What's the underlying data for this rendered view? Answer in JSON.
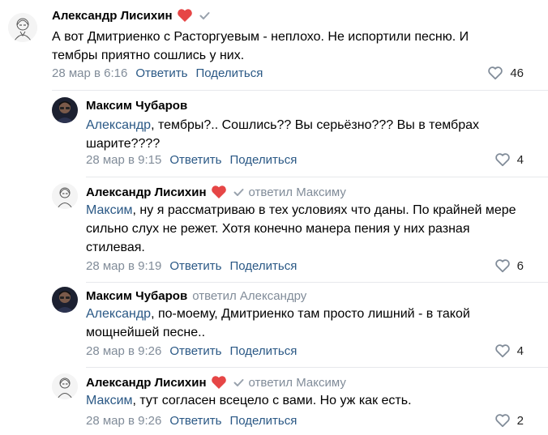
{
  "comments": [
    {
      "author": "Александр Лисихин",
      "replied_to": "",
      "mention": "",
      "text": "А вот Дмитриенко с Расторгуевым - неплохо. Не испортили песню. И тембры приятно сошлись у них.",
      "date": "28 мар в 6:16",
      "reply_label": "Ответить",
      "share_label": "Поделиться",
      "likes": "46",
      "avatar_icon": "sketch-portrait-avatar"
    },
    {
      "author": "Максим Чубаров",
      "replied_to": "",
      "mention": "Александр",
      "text": ", тембры?.. Сошлись?? Вы серьёзно??? Вы в тембрах шарите????",
      "date": "28 мар в 9:15",
      "reply_label": "Ответить",
      "share_label": "Поделиться",
      "likes": "4",
      "avatar_icon": "photo-avatar"
    },
    {
      "author": "Александр Лисихин",
      "replied_to": "ответил Максиму",
      "mention": "Максим",
      "text": ", ну я рассматриваю в тех условиях что даны. По крайней мере сильно слух не режет. Хотя конечно манера пения у них разная стилевая.",
      "date": "28 мар в 9:19",
      "reply_label": "Ответить",
      "share_label": "Поделиться",
      "likes": "6",
      "avatar_icon": "sketch-portrait-avatar"
    },
    {
      "author": "Максим Чубаров",
      "replied_to": "ответил Александру",
      "mention": "Александр",
      "text": ", по-моему, Дмитриенко там просто лишний - в такой мощнейшей песне..",
      "date": "28 мар в 9:26",
      "reply_label": "Ответить",
      "share_label": "Поделиться",
      "likes": "4",
      "avatar_icon": "photo-avatar"
    },
    {
      "author": "Александр Лисихин",
      "replied_to": "ответил Максиму",
      "mention": "Максим",
      "text": ", тут согласен всецело с вами. Но уж как есть.",
      "date": "28 мар в 9:26",
      "reply_label": "Ответить",
      "share_label": "Поделиться",
      "likes": "2",
      "avatar_icon": "sketch-portrait-avatar"
    }
  ],
  "colors": {
    "link": "#2a5885",
    "muted": "#818c99",
    "heart": "#e64646",
    "divider": "#e7e8ec"
  },
  "icons": {
    "badge": "heart-icon",
    "verified": "checkmark-icon",
    "like": "heart-outline-icon"
  }
}
